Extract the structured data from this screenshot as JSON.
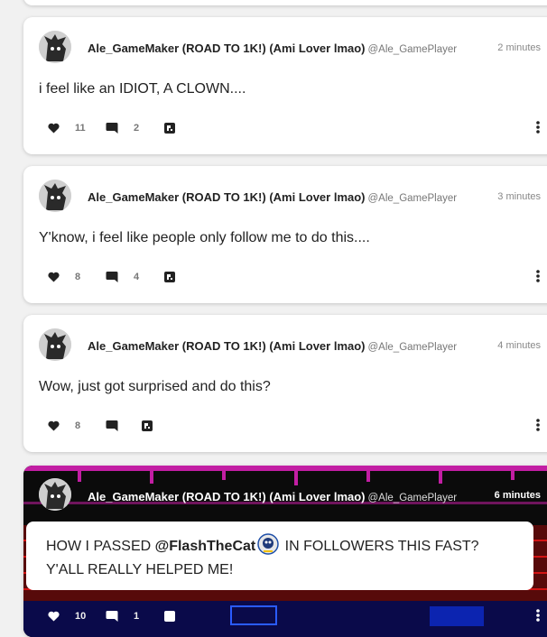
{
  "posts": [
    {
      "author": "Ale_GameMaker (ROAD TO 1K!) (Ami Lover lmao)",
      "handle": "@Ale_GamePlayer",
      "time": "2 minutes",
      "text": "i feel like an IDIOT, A CLOWN....",
      "likes": "11",
      "comments": "2"
    },
    {
      "author": "Ale_GameMaker (ROAD TO 1K!) (Ami Lover lmao)",
      "handle": "@Ale_GamePlayer",
      "time": "3 minutes",
      "text": "Y'know, i feel like people only follow me to do this....",
      "likes": "8",
      "comments": "4"
    },
    {
      "author": "Ale_GameMaker (ROAD TO 1K!) (Ami Lover lmao)",
      "handle": "@Ale_GamePlayer",
      "time": "4 minutes",
      "text": "Wow, just got surprised and do this?",
      "likes": "8",
      "comments": ""
    },
    {
      "author": "Ale_GameMaker (ROAD TO 1K!) (Ami Lover lmao)",
      "handle": "@Ale_GamePlayer",
      "time": "6 minutes",
      "text_part1": "HOW I PASSED ",
      "mention": "@FlashTheCat",
      "text_part2": " IN FOLLOWERS THIS FAST?",
      "text_line2": "Y'ALL REALLY HELPED ME!",
      "likes": "10",
      "comments": "1"
    }
  ],
  "icons": {
    "like": "heart-icon",
    "comment": "comment-icon",
    "remix": "remix-icon",
    "more": "more-vertical-icon"
  },
  "colors": {
    "dark_card_bg": "#0b0b0b",
    "card_bg": "#ffffff",
    "page_bg": "#f1f1f1",
    "accent_magenta": "#c21ea3",
    "accent_red": "#d21414"
  }
}
